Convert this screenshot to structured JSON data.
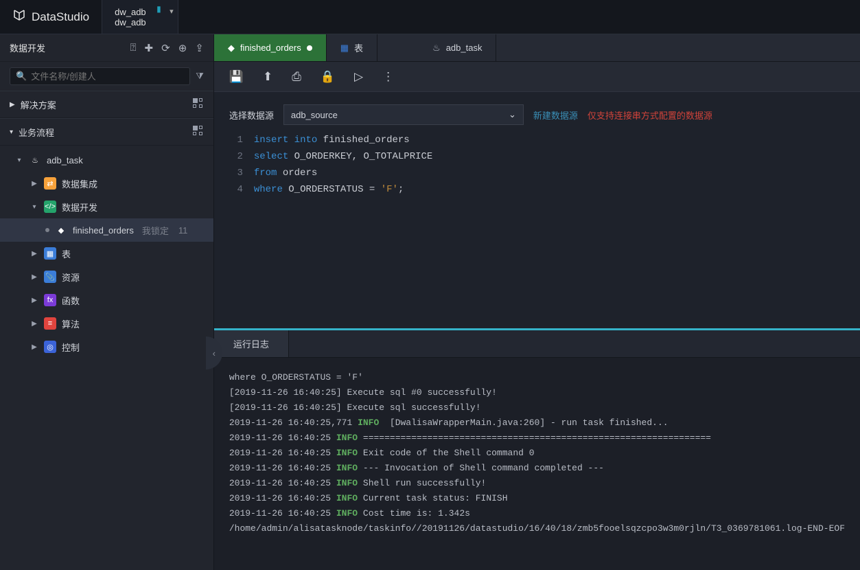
{
  "app": {
    "name": "DataStudio"
  },
  "workspace": {
    "line1": "dw_adb",
    "line2": "dw_adb"
  },
  "sidebar": {
    "title": "数据开发",
    "search_placeholder": "文件名称/创建人",
    "sections": {
      "solution": "解决方案",
      "flow": "业务流程"
    },
    "tree": {
      "task": "adb_task",
      "items": [
        {
          "label": "数据集成"
        },
        {
          "label": "数据开发"
        },
        {
          "label": "表"
        },
        {
          "label": "资源"
        },
        {
          "label": "函数"
        },
        {
          "label": "算法"
        },
        {
          "label": "控制"
        }
      ],
      "file": {
        "name": "finished_orders",
        "status": "我锁定",
        "time": "11"
      }
    }
  },
  "tabs": [
    {
      "label": "finished_orders",
      "dirty": true,
      "active": true
    },
    {
      "label": "表"
    },
    {
      "label": "adb_task"
    }
  ],
  "datasource": {
    "label": "选择数据源",
    "value": "adb_source",
    "new_link": "新建数据源",
    "warn": "仅支持连接串方式配置的数据源"
  },
  "code": {
    "lines": [
      "1",
      "2",
      "3",
      "4"
    ],
    "l1a": "insert",
    "l1b": "into",
    "l1c": " finished_orders",
    "l2a": "select",
    "l2b": " O_ORDERKEY, O_TOTALPRICE",
    "l3a": "from",
    "l3b": " orders",
    "l4a": "where",
    "l4b": " O_ORDERSTATUS = ",
    "l4c": "'F'",
    "l4d": ";"
  },
  "logtab": "运行日志",
  "log": {
    "r0": "where O_ORDERSTATUS = 'F'",
    "r1": "[2019-11-26 16:40:25] Execute sql #0 successfully!",
    "r2": "[2019-11-26 16:40:25] Execute sql successfully!",
    "r3a": "2019-11-26 16:40:25,771 ",
    "r3b": "INFO",
    "r3c": "  [DwalisaWrapperMain.java:260] - run task finished...",
    "r4a": "2019-11-26 16:40:25 ",
    "r4b": "INFO",
    "r4c": " =================================================================",
    "r5a": "2019-11-26 16:40:25 ",
    "r5b": "INFO",
    "r5c": " Exit code of the Shell command 0",
    "r6a": "2019-11-26 16:40:25 ",
    "r6b": "INFO",
    "r6c": " --- Invocation of Shell command completed ---",
    "r7a": "2019-11-26 16:40:25 ",
    "r7b": "INFO",
    "r7c": " Shell run successfully!",
    "r8a": "2019-11-26 16:40:25 ",
    "r8b": "INFO",
    "r8c": " Current task status: FINISH",
    "r9a": "2019-11-26 16:40:25 ",
    "r9b": "INFO",
    "r9c": " Cost time is: 1.342s",
    "r10": "/home/admin/alisatasknode/taskinfo//20191126/datastudio/16/40/18/zmb5fooelsqzcpo3w3m0rjln/T3_0369781061.log-END-EOF"
  }
}
